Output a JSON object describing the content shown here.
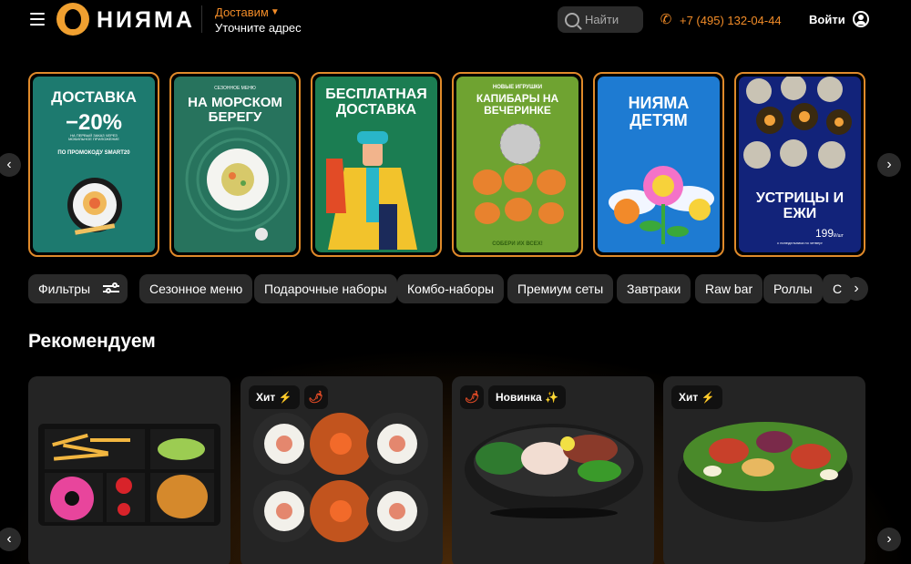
{
  "header": {
    "brand": "НИЯМА",
    "delivery_label": "Доставим",
    "delivery_address": "Уточните адрес",
    "search_placeholder": "Найти",
    "phone": "+7 (495) 132-04-44",
    "login_label": "Войти"
  },
  "banners": [
    {
      "title": "ДОСТАВКА",
      "big": "−20%",
      "small": "НА ПЕРВЫЙ ЗАКАЗ ЧЕРЕЗ МОБИЛЬНОЕ ПРИЛОЖЕНИЕ",
      "promo": "ПО ПРОМОКОДУ SMART20"
    },
    {
      "kicker": "СЕЗОННОЕ МЕНЮ",
      "title": "НА МОРСКОМ БЕРЕГУ"
    },
    {
      "title": "БЕСПЛАТНАЯ ДОСТАВКА"
    },
    {
      "kicker": "НОВЫЕ ИГРУШКИ",
      "title": "КАПИБАРЫ НА ВЕЧЕРИНКЕ",
      "bottom": "СОБЕРИ ИХ ВСЕХ!"
    },
    {
      "title": "НИЯМА ДЕТЯМ"
    },
    {
      "title": "УСТРИЦЫ И ЕЖИ",
      "price": "199",
      "price_unit": "₽/шт",
      "note": "с понедельника по четверг"
    }
  ],
  "filters": {
    "filters_label": "Фильтры",
    "categories": [
      "Сезонное меню",
      "Подарочные наборы",
      "Комбо-наборы",
      "Премиум сеты",
      "Завтраки",
      "Raw bar",
      "Роллы",
      "С"
    ]
  },
  "recommend": {
    "title": "Рекомендуем",
    "cards": [
      {
        "badges": []
      },
      {
        "badges": [
          "Хит ⚡"
        ],
        "spicy": true
      },
      {
        "badges": [
          "Новинка ✨"
        ],
        "spicy_first": true
      },
      {
        "badges": [
          "Хит ⚡"
        ]
      }
    ]
  },
  "icons": {
    "arrow_left": "‹",
    "arrow_right": "›",
    "chili": "🌶",
    "phone": "✆"
  },
  "colors": {
    "accent": "#f28c28",
    "background": "#000000",
    "chip": "#2a2a2a",
    "card": "#242424"
  }
}
